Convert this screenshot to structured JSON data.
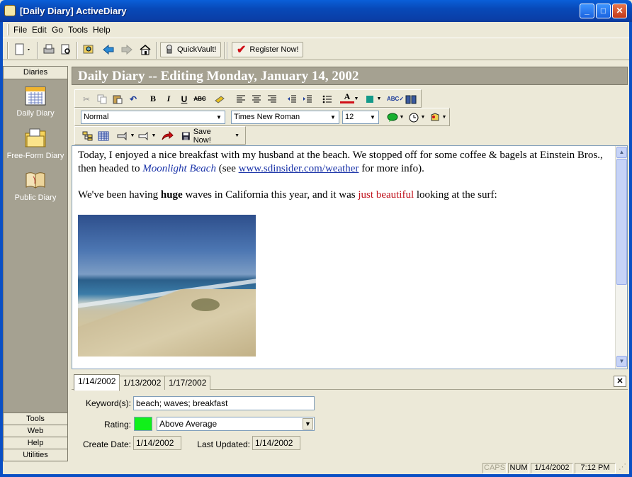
{
  "window": {
    "title": "[Daily Diary]  ActiveDiary",
    "minimize": "_",
    "maximize": "□",
    "close": "✕"
  },
  "menu": [
    "File",
    "Edit",
    "Go",
    "Tools",
    "Help"
  ],
  "toolbar": {
    "quickvault_label": "QuickVault!",
    "register_label": "Register Now!"
  },
  "sidebar": {
    "header": "Diaries",
    "items": [
      {
        "label": "Daily Diary",
        "icon": "calendar-icon"
      },
      {
        "label": "Free-Form Diary",
        "icon": "folder-icon"
      },
      {
        "label": "Public Diary",
        "icon": "open-book-icon"
      }
    ],
    "bottom": [
      "Tools",
      "Web",
      "Help",
      "Utilities"
    ]
  },
  "page": {
    "heading": "Daily Diary -- Editing Monday, January 14, 2002"
  },
  "format": {
    "style": "Normal",
    "font": "Times New Roman",
    "size": "12",
    "save_label": "Save Now!"
  },
  "entry": {
    "p1_a": "Today, I enjoyed a nice breakfast with my husband at the beach.  We stopped off for some coffee & bagels at Einstein Bros., then headed to ",
    "p1_place": "Moonlight Beach",
    "p1_b": " (see ",
    "p1_link": "www.sdinsider.com/weather",
    "p1_c": " for more info).",
    "p2_a": "We've been having ",
    "p2_bold": "huge",
    "p2_b": " waves in California this year, and it was ",
    "p2_red": "just beautiful",
    "p2_c": " looking at the surf:"
  },
  "tabs": [
    "1/14/2002",
    "1/13/2002",
    "1/17/2002"
  ],
  "properties": {
    "keywords_label": "Keyword(s):",
    "keywords_value": "beach; waves; breakfast",
    "rating_label": "Rating:",
    "rating_value": "Above Average",
    "rating_color": "#11f01a",
    "create_label": "Create Date:",
    "create_value": "1/14/2002",
    "updated_label": "Last Updated:",
    "updated_value": "1/14/2002"
  },
  "status": {
    "caps": "CAPS",
    "num": "NUM",
    "date": "1/14/2002",
    "time": "7:12 PM"
  },
  "colors": {
    "title_bar": "#0a4fc4",
    "panel_gray": "#a5a191",
    "link_blue": "#1a33a8",
    "accent_red": "#c0141e"
  }
}
